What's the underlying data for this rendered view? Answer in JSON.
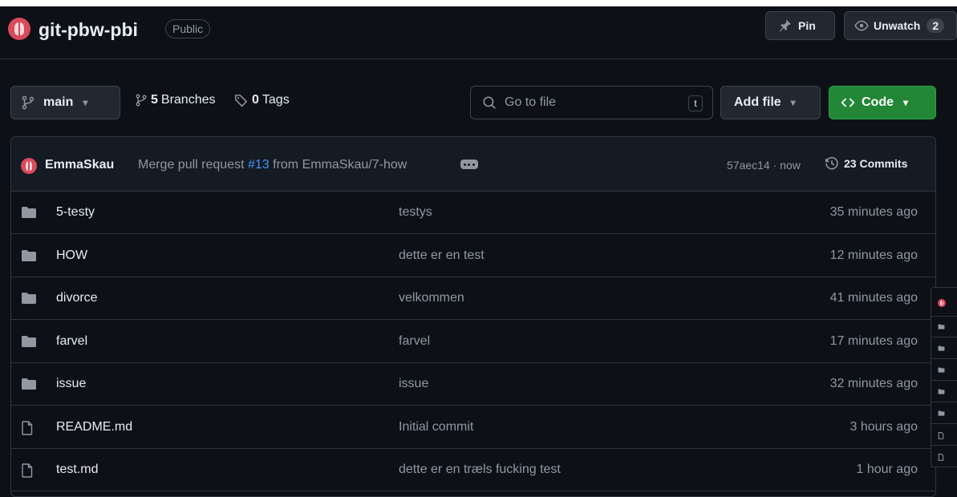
{
  "repo": {
    "name": "git-pbw-pbi",
    "visibility": "Public",
    "pin_label": "Pin",
    "unwatch_label": "Unwatch",
    "watch_count": "2"
  },
  "toolbar": {
    "branch": "main",
    "branches_count": "5",
    "branches_label": "Branches",
    "tags_count": "0",
    "tags_label": "Tags",
    "goto_placeholder": "Go to file",
    "goto_shortcut": "t",
    "add_file_label": "Add file",
    "code_label": "Code"
  },
  "latest_commit": {
    "author": "EmmaSkau",
    "message_prefix": "Merge pull request",
    "pr_number": "#13",
    "message_suffix": "from EmmaSkau/7-how",
    "hash_time": "57aec14 · now",
    "commits_count": "23 Commits"
  },
  "files": [
    {
      "type": "folder",
      "name": "5-testy",
      "message": "testys",
      "time": "35 minutes ago"
    },
    {
      "type": "folder",
      "name": "HOW",
      "message": "dette er en test",
      "time": "12 minutes ago"
    },
    {
      "type": "folder",
      "name": "divorce",
      "message": "velkommen",
      "time": "41 minutes ago"
    },
    {
      "type": "folder",
      "name": "farvel",
      "message": "farvel",
      "time": "17 minutes ago"
    },
    {
      "type": "folder",
      "name": "issue",
      "message": "issue",
      "time": "32 minutes ago"
    },
    {
      "type": "file",
      "name": "README.md",
      "message": "Initial commit",
      "time": "3 hours ago"
    },
    {
      "type": "file",
      "name": "test.md",
      "message": "dette er en træls fucking test",
      "time": "1 hour ago"
    }
  ],
  "colors": {
    "background": "#0d1117",
    "border": "#30363d",
    "link": "#4493f8",
    "code_button": "#238636",
    "muted_text": "#9198a1"
  }
}
